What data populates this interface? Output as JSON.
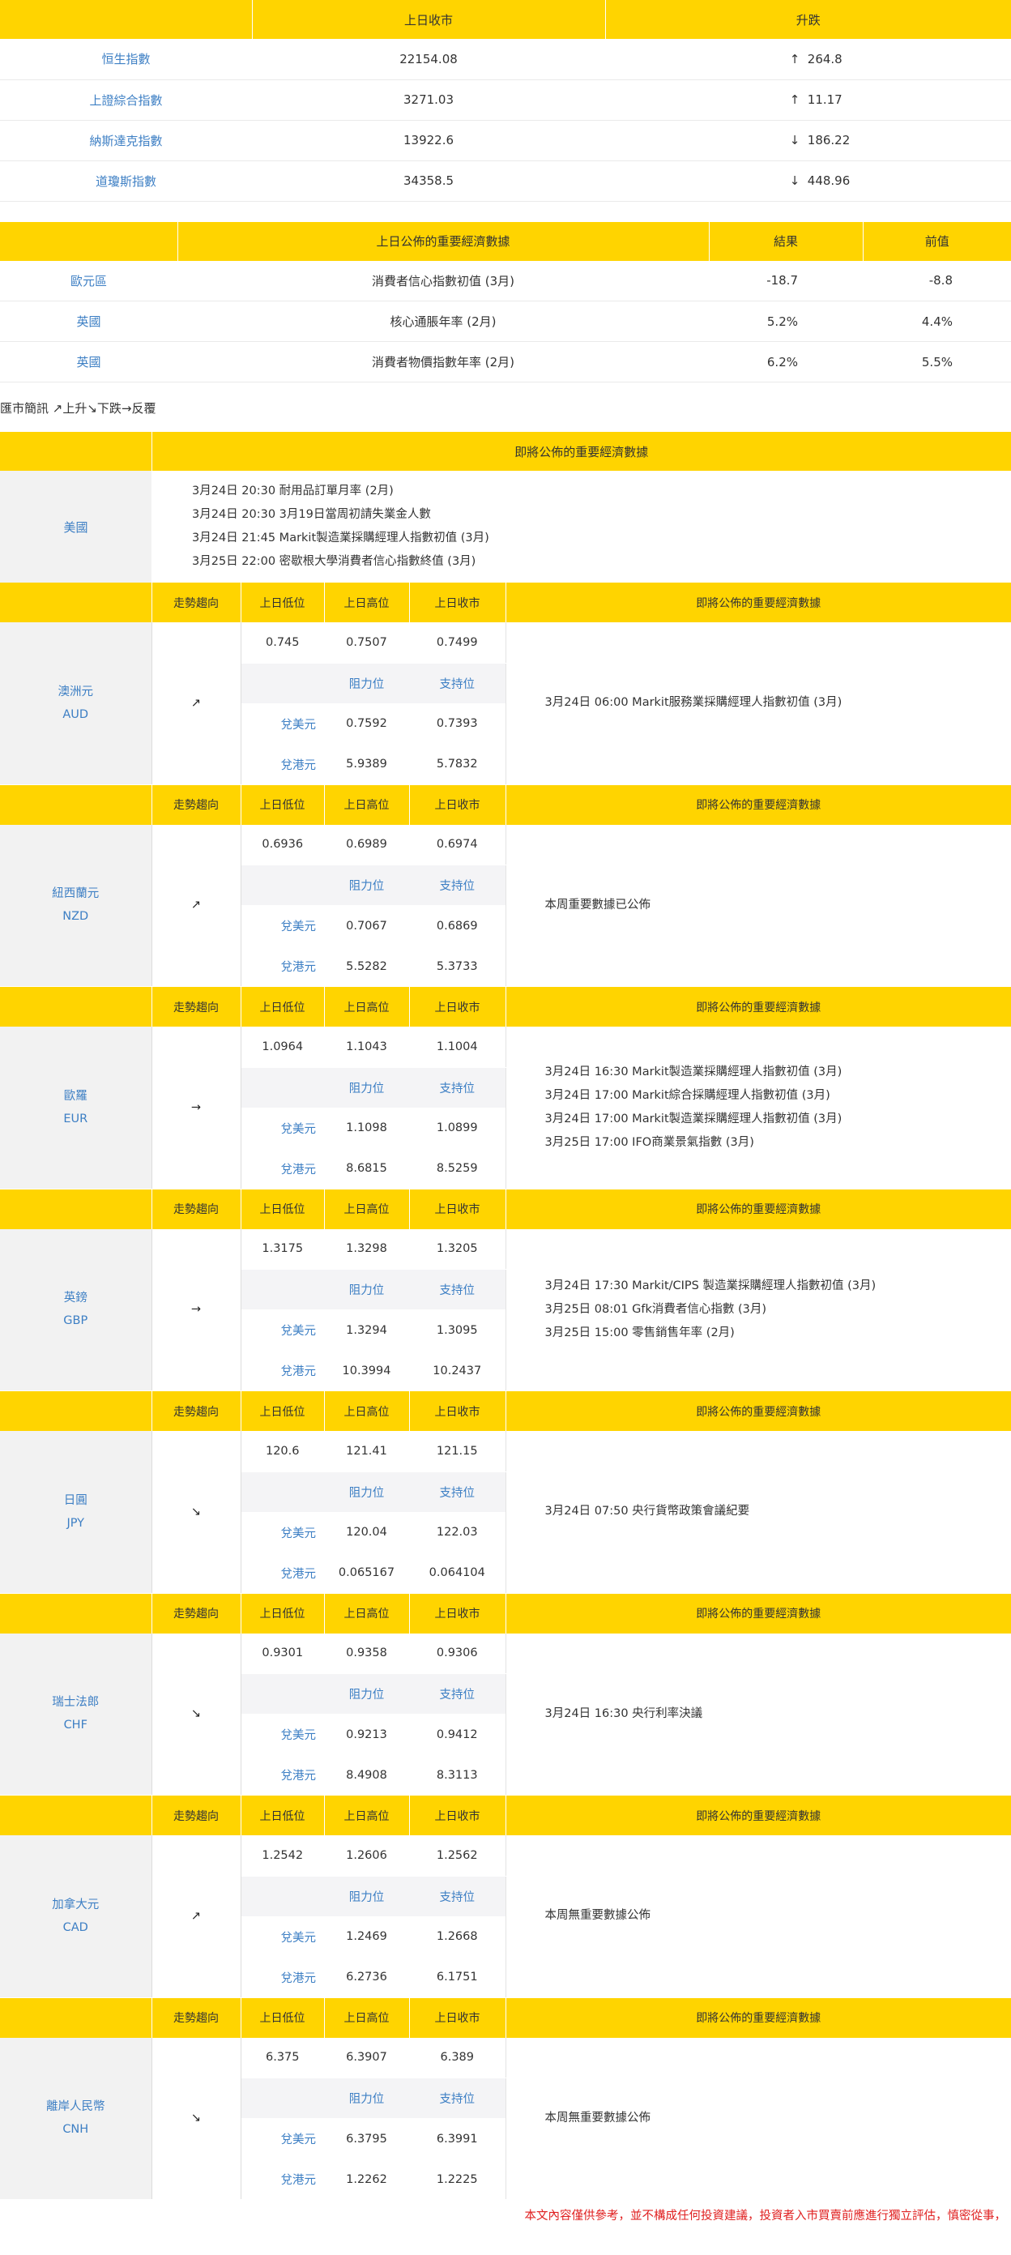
{
  "indices": {
    "headers": [
      "",
      "上日收市",
      "升跌"
    ],
    "rows": [
      {
        "name": "恒生指數",
        "close": "22154.08",
        "dir": "↑",
        "change": "264.8"
      },
      {
        "name": "上證綜合指數",
        "close": "3271.03",
        "dir": "↑",
        "change": "11.17"
      },
      {
        "name": "納斯達克指數",
        "close": "13922.6",
        "dir": "↓",
        "change": "186.22"
      },
      {
        "name": "道瓊斯指數",
        "close": "34358.5",
        "dir": "↓",
        "change": "448.96"
      }
    ]
  },
  "economic": {
    "headers": [
      "",
      "上日公佈的重要經濟數據",
      "結果",
      "前值"
    ],
    "rows": [
      {
        "region": "歐元區",
        "item": "消費者信心指數初值 (3月)",
        "result": "-18.7",
        "previous": "-8.8"
      },
      {
        "region": "英國",
        "item": "核心通脹年率 (2月)",
        "result": "5.2%",
        "previous": "4.4%"
      },
      {
        "region": "英國",
        "item": "消費者物價指數年率 (2月)",
        "result": "6.2%",
        "previous": "5.5%"
      }
    ]
  },
  "legend": "匯市簡訊 ↗上升↘下跌→反覆",
  "upcoming": {
    "header": "即將公佈的重要經濟數據",
    "region": "美國",
    "events": [
      "3月24日 20:30 耐用品訂單月率 (2月)",
      "3月24日 20:30 3月19日當周初請失業金人數",
      "3月24日 21:45 Markit製造業採購經理人指數初值 (3月)",
      "3月25日 22:00 密歇根大學消費者信心指數終值 (3月)"
    ]
  },
  "ccy_headers": {
    "trend": "走勢趨向",
    "low": "上日低位",
    "high": "上日高位",
    "close": "上日收市",
    "events": "即將公佈的重要經濟數據",
    "resistance": "阻力位",
    "support": "支持位",
    "vs_usd": "兌美元",
    "vs_hkd": "兌港元"
  },
  "currencies": [
    {
      "name": "澳洲元",
      "code": "AUD",
      "trend": "↗",
      "low": "0.745",
      "high": "0.7507",
      "close": "0.7499",
      "usd_res": "0.7592",
      "usd_sup": "0.7393",
      "hkd_res": "5.9389",
      "hkd_sup": "5.7832",
      "events": [
        "3月24日 06:00 Markit服務業採購經理人指數初值 (3月)"
      ]
    },
    {
      "name": "紐西蘭元",
      "code": "NZD",
      "trend": "↗",
      "low": "0.6936",
      "high": "0.6989",
      "close": "0.6974",
      "usd_res": "0.7067",
      "usd_sup": "0.6869",
      "hkd_res": "5.5282",
      "hkd_sup": "5.3733",
      "events": [
        "本周重要數據已公佈"
      ]
    },
    {
      "name": "歐羅",
      "code": "EUR",
      "trend": "→",
      "low": "1.0964",
      "high": "1.1043",
      "close": "1.1004",
      "usd_res": "1.1098",
      "usd_sup": "1.0899",
      "hkd_res": "8.6815",
      "hkd_sup": "8.5259",
      "events": [
        "3月24日 16:30 Markit製造業採購經理人指數初值 (3月)",
        "3月24日 17:00 Markit綜合採購經理人指數初值 (3月)",
        "3月24日 17:00 Markit製造業採購經理人指數初值 (3月)",
        "3月25日 17:00 IFO商業景氣指數 (3月)"
      ]
    },
    {
      "name": "英鎊",
      "code": "GBP",
      "trend": "→",
      "low": "1.3175",
      "high": "1.3298",
      "close": "1.3205",
      "usd_res": "1.3294",
      "usd_sup": "1.3095",
      "hkd_res": "10.3994",
      "hkd_sup": "10.2437",
      "events": [
        "3月24日 17:30 Markit/CIPS 製造業採購經理人指數初值 (3月)",
        "3月25日 08:01 Gfk消費者信心指數 (3月)",
        "3月25日 15:00 零售銷售年率 (2月)"
      ]
    },
    {
      "name": "日圓",
      "code": "JPY",
      "trend": "↘",
      "low": "120.6",
      "high": "121.41",
      "close": "121.15",
      "usd_res": "120.04",
      "usd_sup": "122.03",
      "hkd_res": "0.065167",
      "hkd_sup": "0.064104",
      "events": [
        "3月24日 07:50 央行貨幣政策會議紀要"
      ]
    },
    {
      "name": "瑞士法郎",
      "code": "CHF",
      "trend": "↘",
      "low": "0.9301",
      "high": "0.9358",
      "close": "0.9306",
      "usd_res": "0.9213",
      "usd_sup": "0.9412",
      "hkd_res": "8.4908",
      "hkd_sup": "8.3113",
      "events": [
        "3月24日 16:30 央行利率決議"
      ]
    },
    {
      "name": "加拿大元",
      "code": "CAD",
      "trend": "↗",
      "low": "1.2542",
      "high": "1.2606",
      "close": "1.2562",
      "usd_res": "1.2469",
      "usd_sup": "1.2668",
      "hkd_res": "6.2736",
      "hkd_sup": "6.1751",
      "events": [
        "本周無重要數據公佈"
      ]
    },
    {
      "name": "離岸人民幣",
      "code": "CNH",
      "trend": "↘",
      "low": "6.375",
      "high": "6.3907",
      "close": "6.389",
      "usd_res": "6.3795",
      "usd_sup": "6.3991",
      "hkd_res": "1.2262",
      "hkd_sup": "1.2225",
      "events": [
        "本周無重要數據公佈"
      ]
    }
  ],
  "disclaimer": "本文內容僅供參考，並不構成任何投資建議，投資者入市買賣前應進行獨立評估，慎密從事，"
}
